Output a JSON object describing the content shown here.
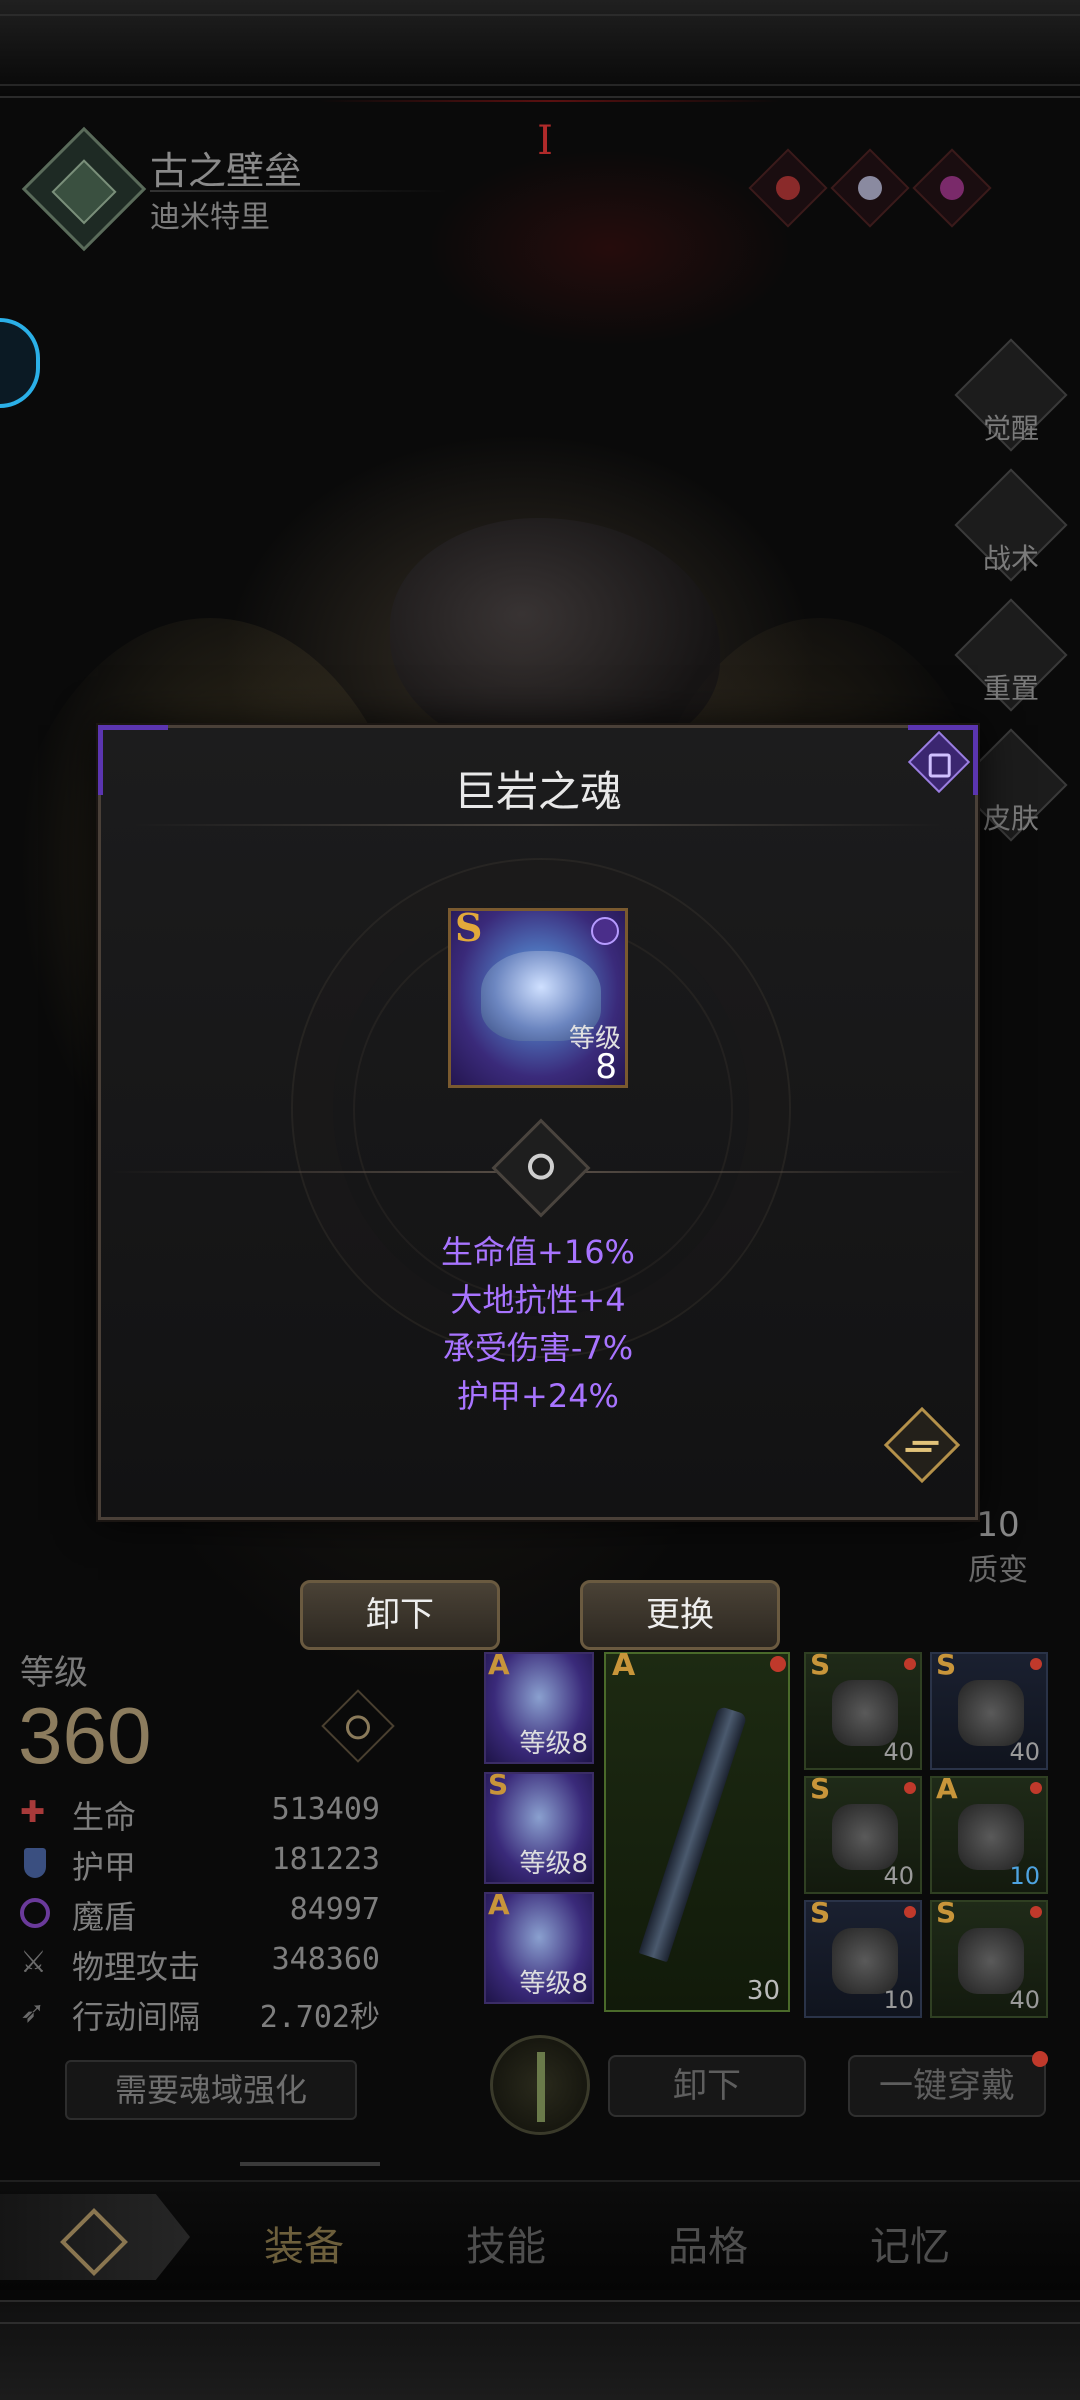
{
  "hero": {
    "title": "古之壁垒",
    "name": "迪米特里",
    "rank_mark": "I"
  },
  "side_buttons": [
    {
      "label": "觉醒",
      "icon": "awaken-icon"
    },
    {
      "label": "战术",
      "icon": "tactics-icon"
    },
    {
      "label": "重置",
      "icon": "reset-icon"
    },
    {
      "label": "皮肤",
      "icon": "skin-icon"
    }
  ],
  "mutate": {
    "count": "10",
    "label": "质变"
  },
  "dialog": {
    "title": "巨岩之魂",
    "item": {
      "grade": "S",
      "level_label": "等级",
      "level": "8"
    },
    "stats": [
      "生命值+16%",
      "大地抗性+4",
      "承受伤害-7%",
      "护甲+24%"
    ],
    "buttons": {
      "unequip": "卸下",
      "replace": "更换"
    }
  },
  "character": {
    "level_label": "等级",
    "level": "360",
    "stats": [
      {
        "name": "生命",
        "value": "513409",
        "icon": "health-cross-icon",
        "color": "#a83a3a"
      },
      {
        "name": "护甲",
        "value": "181223",
        "icon": "armor-shield-icon",
        "color": "#4a66a8"
      },
      {
        "name": "魔盾",
        "value": "84997",
        "icon": "magic-shield-icon",
        "color": "#7a4aaa"
      },
      {
        "name": "物理攻击",
        "value": "348360",
        "icon": "crossed-swords-icon",
        "color": "#6a6a6a"
      },
      {
        "name": "行动间隔",
        "value": "2.702秒",
        "icon": "wing-speed-icon",
        "color": "#6a6a6a"
      }
    ],
    "need_button": "需要魂域强化"
  },
  "souls": [
    {
      "grade": "A",
      "level": "等级8"
    },
    {
      "grade": "S",
      "level": "等级8"
    },
    {
      "grade": "A",
      "level": "等级8"
    }
  ],
  "weapon": {
    "grade": "A",
    "level": "30"
  },
  "gear": [
    {
      "grade": "S",
      "level": "40"
    },
    {
      "grade": "S",
      "level": "40"
    },
    {
      "grade": "S",
      "level": "40"
    },
    {
      "grade": "A",
      "level": "10"
    },
    {
      "grade": "S",
      "level": "10"
    },
    {
      "grade": "S",
      "level": "40"
    }
  ],
  "actions": {
    "unequip_all": "卸下",
    "equip_all": "一键穿戴"
  },
  "nav": {
    "tabs": [
      "装备",
      "技能",
      "品格",
      "记忆"
    ],
    "active": "装备"
  },
  "colors": {
    "accent_purple": "#a874ff",
    "gold": "#c8953a",
    "equip_red_dot": "#c0392b"
  }
}
